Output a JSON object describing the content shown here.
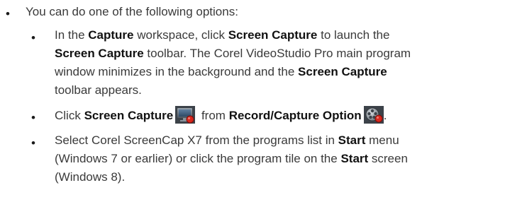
{
  "intro": "You can do one of the following options:",
  "options": {
    "opt1": {
      "l1_a": "In the ",
      "l1_b": "Capture",
      "l1_c": " workspace, click ",
      "l1_d": "Screen Capture",
      "l1_e": " to launch the",
      "l2_a": "Screen Capture",
      "l2_b": " toolbar. The Corel VideoStudio Pro main program",
      "l3_a": "window minimizes in the background and the ",
      "l3_b": "Screen Capture",
      "l4_a": "toolbar appears."
    },
    "opt2": {
      "a": "Click ",
      "b": "Screen Capture",
      "c": " from ",
      "d": "Record/Capture Option",
      "e": "."
    },
    "opt3": {
      "l1_a": "Select Corel ScreenCap X7 from the programs list in ",
      "l1_b": "Start",
      "l1_c": " menu",
      "l2_a": "(Windows 7 or earlier) or click the program tile on the ",
      "l2_b": "Start",
      "l2_c": " screen",
      "l3_a": "(Windows 8)."
    }
  },
  "icons": {
    "screen_capture": "screen-capture-icon",
    "record_capture_option": "record-capture-option-icon"
  },
  "colors": {
    "text": "#3a3a3a",
    "bold": "#111111",
    "record_red": "#d9261c"
  }
}
